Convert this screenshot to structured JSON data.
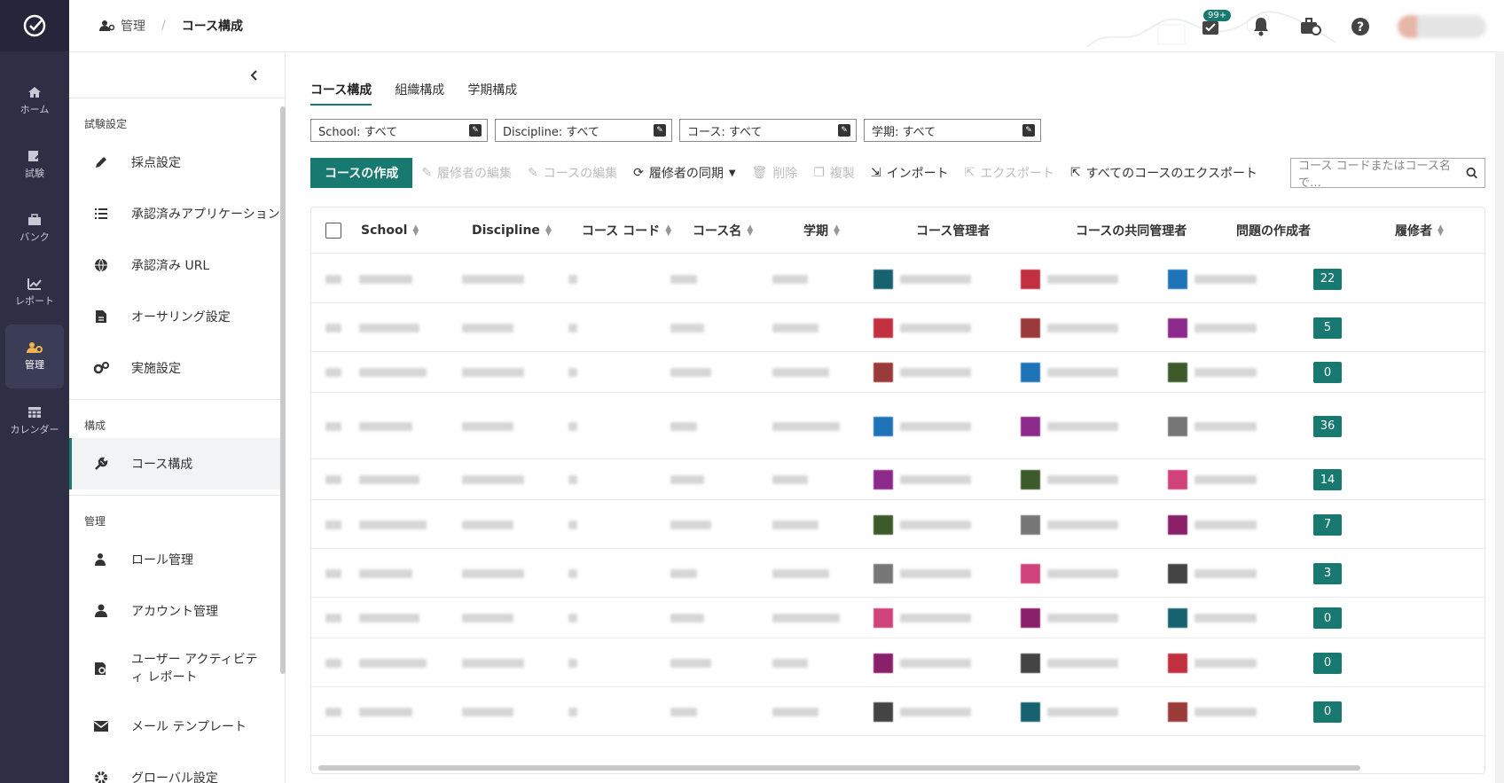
{
  "breadcrumb": {
    "section": "管理",
    "current": "コース構成"
  },
  "notifications_badge": "99+",
  "rail": [
    {
      "label": "ホーム",
      "icon": "home-icon"
    },
    {
      "label": "試験",
      "icon": "exam-icon"
    },
    {
      "label": "バンク",
      "icon": "bank-icon"
    },
    {
      "label": "レポート",
      "icon": "report-icon"
    },
    {
      "label": "管理",
      "icon": "admin-icon"
    },
    {
      "label": "カレンダー",
      "icon": "calendar-icon"
    }
  ],
  "sidebar": {
    "section1": "試験設定",
    "items1": [
      "採点設定",
      "承認済みアプリケーション",
      "承認済み URL",
      "オーサリング設定",
      "実施設定"
    ],
    "section2": "構成",
    "items2": [
      "コース構成"
    ],
    "section3": "管理",
    "items3": [
      "ロール管理",
      "アカウント管理",
      "ユーザー アクティビティ レポート",
      "メール テンプレート",
      "グローバル設定"
    ]
  },
  "tabs": [
    "コース構成",
    "組織構成",
    "学期構成"
  ],
  "filters": [
    "School: すべて",
    "Discipline: すべて",
    "コース: すべて",
    "学期: すべて"
  ],
  "toolbar": {
    "create": "コースの作成",
    "edit_enrollees": "履修者の編集",
    "edit_course": "コースの編集",
    "sync": "履修者の同期",
    "delete": "削除",
    "duplicate": "複製",
    "import": "インポート",
    "export": "エクスポート",
    "export_all": "すべてのコースのエクスポート",
    "search_placeholder": "コース コードまたはコース名で…"
  },
  "table": {
    "headers": [
      "School",
      "Discipline",
      "コース コード",
      "コース名",
      "学期",
      "コース管理者",
      "コースの共同管理者",
      "問題の作成者",
      "履修者"
    ],
    "counts": [
      "22",
      "5",
      "0",
      "36",
      "14",
      "7",
      "3",
      "0",
      "0",
      "0"
    ]
  },
  "colors": {
    "accent": "#17796f",
    "rail": "#2e2f45"
  }
}
